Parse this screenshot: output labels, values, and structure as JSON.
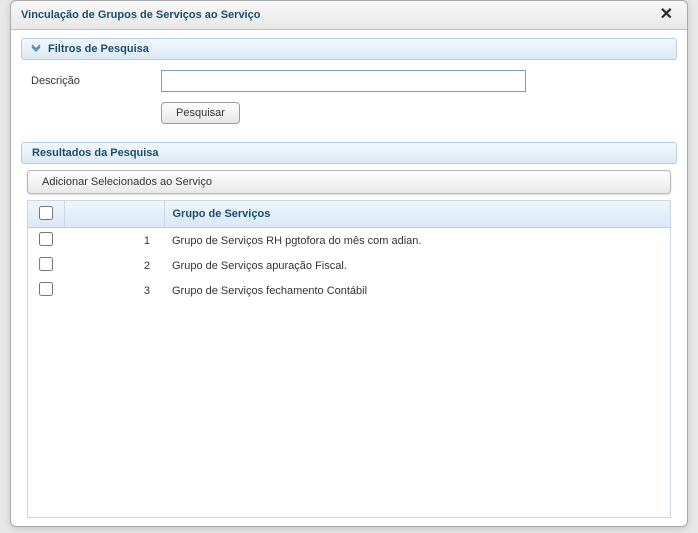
{
  "dialog": {
    "title": "Vinculação de Grupos de Serviços ao Serviço"
  },
  "filters": {
    "section_title": "Filtros de Pesquisa",
    "descricao_label": "Descrição",
    "descricao_value": "",
    "search_button": "Pesquisar"
  },
  "results": {
    "section_title": "Resultados da Pesquisa",
    "action_button": "Adicionar Selecionados ao Serviço",
    "columns": {
      "check": "",
      "row": "",
      "grupo": "Grupo de Serviços"
    },
    "rows": [
      {
        "index": "1",
        "grupo": "Grupo de Serviços RH pgtofora do mês com adian."
      },
      {
        "index": "2",
        "grupo": "Grupo de Serviços apuração Fiscal."
      },
      {
        "index": "3",
        "grupo": "Grupo de Serviços fechamento Contábil"
      }
    ]
  }
}
